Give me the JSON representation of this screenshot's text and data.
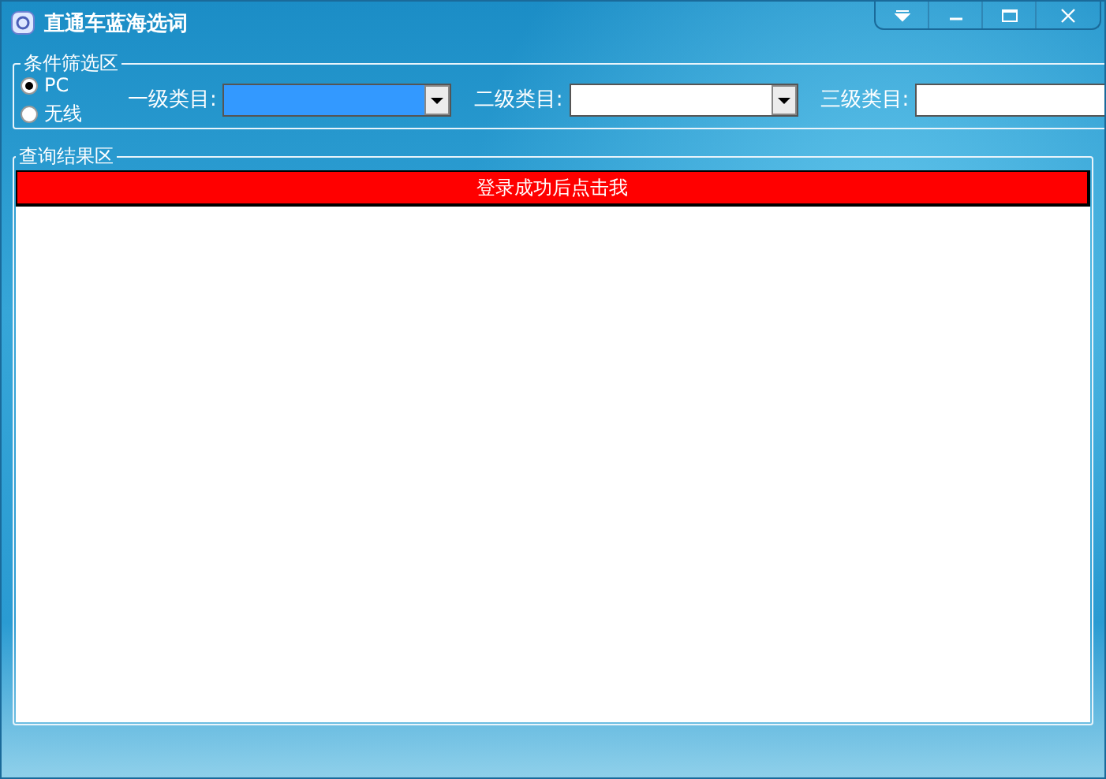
{
  "window": {
    "title": "直通车蓝海选词"
  },
  "filter_group": {
    "legend": "条件筛选区",
    "platforms": [
      {
        "label": "PC",
        "selected": true
      },
      {
        "label": "无线",
        "selected": false
      }
    ],
    "categories": [
      {
        "label": "一级类目:",
        "focused": true
      },
      {
        "label": "二级类目:",
        "focused": false
      },
      {
        "label": "三级类目:",
        "focused": false
      }
    ]
  },
  "results_group": {
    "legend": "查询结果区",
    "button": "登录成功后点击我"
  }
}
